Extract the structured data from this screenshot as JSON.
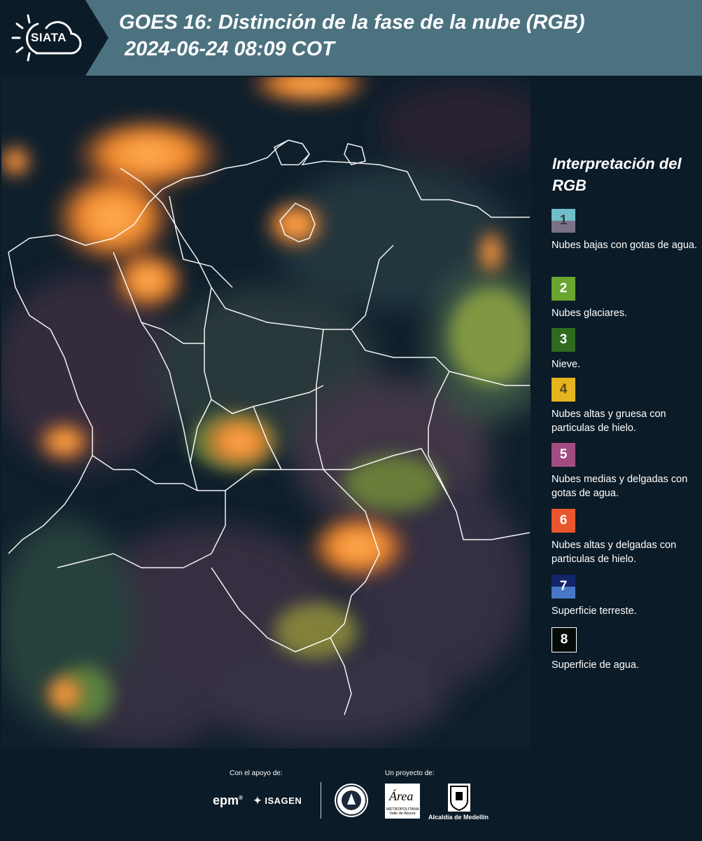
{
  "header": {
    "logo_text": "SIATA",
    "title": "GOES 16: Distinción de la fase de la nube (RGB)",
    "datetime": "2024-06-24 08:09 COT"
  },
  "legend": {
    "title": "Interpretación del RGB",
    "items": [
      {
        "number": "1",
        "label": "Nubes bajas con gotas de agua.",
        "color_top": "#6fbfc9",
        "color_bottom": "#7a7088",
        "text_color": "#3e3a48"
      },
      {
        "number": "2",
        "label": "Nubes glaciares.",
        "color_top": "#69a52f",
        "color_bottom": "#69a52f",
        "text_color": "#ffffff"
      },
      {
        "number": "3",
        "label": "Nieve.",
        "color_top": "#2f6a1f",
        "color_bottom": "#2f6a1f",
        "text_color": "#ffffff"
      },
      {
        "number": "4",
        "label": "Nubes altas y gruesa con particulas de hielo.",
        "color_top": "#e4b51e",
        "color_bottom": "#e4b51e",
        "text_color": "#5a4a14"
      },
      {
        "number": "5",
        "label": "Nubes medias y delgadas con gotas de agua.",
        "color_top": "#a24c82",
        "color_bottom": "#a24c82",
        "text_color": "#ffffff"
      },
      {
        "number": "6",
        "label": "Nubes altas y delgadas con particulas de hielo.",
        "color_top": "#e9562e",
        "color_bottom": "#e9562e",
        "text_color": "#ffffff"
      },
      {
        "number": "7",
        "label": "Superficie terreste.",
        "color_top": "#13246a",
        "color_bottom": "#4778c8",
        "text_color": "#ffffff"
      },
      {
        "number": "8",
        "label": "Superficie de agua.",
        "color_top": "#050c08",
        "color_bottom": "#050c08",
        "text_color": "#ffffff"
      }
    ]
  },
  "footer": {
    "support_label": "Con el apoyo de:",
    "project_label": "Un proyecto de:",
    "epm_text": "epm",
    "isagen_text": "ISAGEN",
    "metro_text": "METROPOLITANA Valle de Aburrá",
    "metro_script": "Área",
    "alcaldia_text": "Alcaldía de Medellín"
  }
}
